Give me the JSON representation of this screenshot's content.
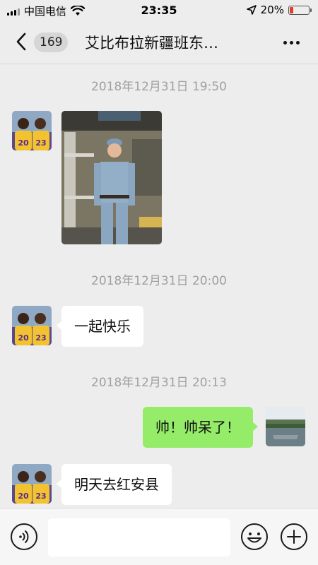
{
  "status_bar": {
    "carrier": "中国电信",
    "time": "23:35",
    "battery": "20%",
    "battery_level": 0.2
  },
  "header": {
    "unread_count": "169",
    "title": "艾比布拉新疆班东…"
  },
  "messages": [
    {
      "timestamp": "2018年12月31日 19:50",
      "sender": "contact",
      "type": "image"
    },
    {
      "timestamp": "2018年12月31日 20:00",
      "sender": "contact",
      "type": "text",
      "text": "一起快乐"
    },
    {
      "timestamp": "2018年12月31日 20:13",
      "sender": "me",
      "type": "text",
      "text": "帅！帅呆了！"
    },
    {
      "sender": "contact",
      "type": "text",
      "text": "明天去红安县"
    }
  ],
  "input": {
    "value": "",
    "placeholder": ""
  },
  "colors": {
    "background": "#ededed",
    "outgoing_bubble": "#95ec69",
    "incoming_bubble": "#ffffff",
    "battery_low": "#e43b33"
  }
}
